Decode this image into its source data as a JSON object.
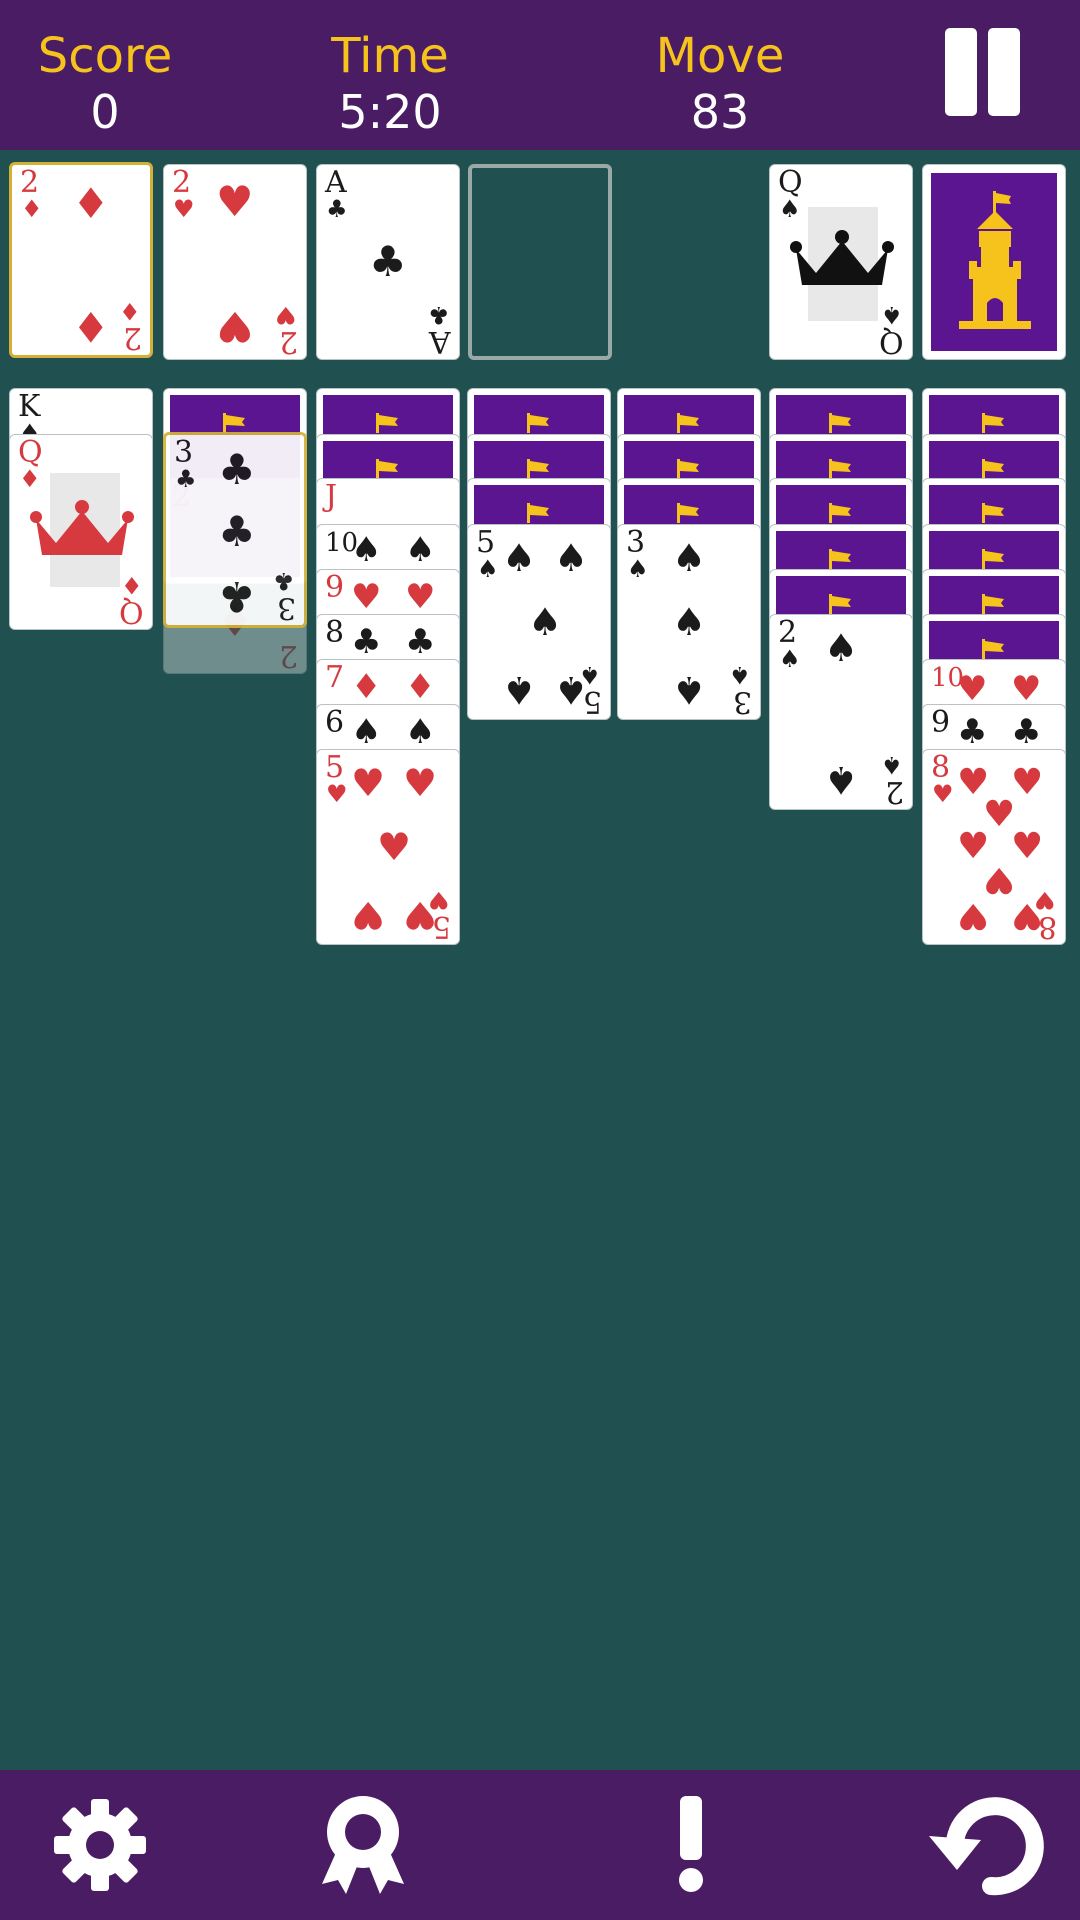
{
  "header": {
    "score_label": "Score",
    "score_value": "0",
    "time_label": "Time",
    "time_value": "5:20",
    "move_label": "Move",
    "move_value": "83",
    "pause_icon": "pause-icon"
  },
  "foundations": [
    {
      "rank": "2",
      "suit": "♦",
      "color": "red",
      "selected": true
    },
    {
      "rank": "2",
      "suit": "♥",
      "color": "red"
    },
    {
      "rank": "A",
      "suit": "♣",
      "color": "black"
    },
    {
      "rank": "",
      "suit": "",
      "empty": true
    }
  ],
  "waste": {
    "rank": "Q",
    "suit": "♠",
    "color": "black"
  },
  "stock": {
    "state": "face-down",
    "icon": "tower-icon"
  },
  "tableau": [
    {
      "hidden": 0,
      "face_up": [
        {
          "rank": "K",
          "suit": "♠"
        },
        {
          "rank": "Q",
          "suit": "♦"
        }
      ]
    },
    {
      "hidden": 1,
      "face_up": [
        {
          "rank": "3",
          "suit": "♣",
          "selected": true
        },
        {
          "rank": "2",
          "suit": "♦",
          "ghost": true
        }
      ]
    },
    {
      "hidden": 2,
      "face_up": [
        {
          "rank": "J",
          "suit": "♥"
        },
        {
          "rank": "10",
          "suit": "♠"
        },
        {
          "rank": "9",
          "suit": "♥"
        },
        {
          "rank": "8",
          "suit": "♣"
        },
        {
          "rank": "7",
          "suit": "♦"
        },
        {
          "rank": "6",
          "suit": "♠"
        },
        {
          "rank": "5",
          "suit": "♥"
        }
      ]
    },
    {
      "hidden": 3,
      "face_up": [
        {
          "rank": "5",
          "suit": "♠"
        }
      ]
    },
    {
      "hidden": 3,
      "face_up": [
        {
          "rank": "3",
          "suit": "♠"
        }
      ]
    },
    {
      "hidden": 5,
      "face_up": [
        {
          "rank": "2",
          "suit": "♠"
        }
      ]
    },
    {
      "hidden": 6,
      "face_up": [
        {
          "rank": "10",
          "suit": "♥"
        },
        {
          "rank": "9",
          "suit": "♣"
        },
        {
          "rank": "8",
          "suit": "♥"
        }
      ]
    }
  ],
  "toolbar": {
    "settings_icon": "gear-icon",
    "achievements_icon": "ribbon-icon",
    "hint_icon": "exclamation-icon",
    "undo_icon": "undo-icon"
  },
  "colors": {
    "felt": "#215050",
    "bar": "#4a1c63",
    "accent": "#f6c21c",
    "card_back": "#5c1591",
    "red": "#d63a3f",
    "black": "#1b1b1b"
  }
}
